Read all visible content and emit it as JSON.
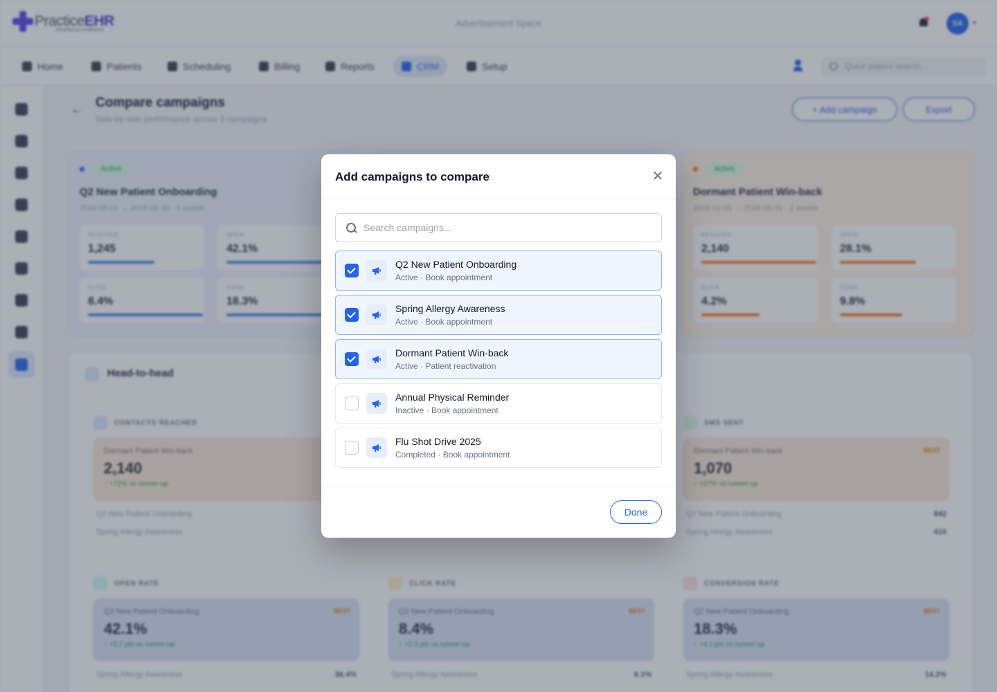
{
  "header": {
    "logo_text_plain": "Practice",
    "logo_text_bold": "EHR",
    "logo_tagline": "Simplifying Healthcare",
    "ad_space": "Advertisement Space",
    "avatar_initials": "SA",
    "quick_search_placeholder": "Quick patient search..."
  },
  "nav": {
    "items": [
      {
        "label": "Home",
        "icon": "home-icon"
      },
      {
        "label": "Patients",
        "icon": "user-icon"
      },
      {
        "label": "Scheduling",
        "icon": "calendar-icon"
      },
      {
        "label": "Billing",
        "icon": "file-icon"
      },
      {
        "label": "Reports",
        "icon": "chart-icon"
      },
      {
        "label": "CRM",
        "icon": "megaphone-icon",
        "active": true
      },
      {
        "label": "Setup",
        "icon": "gear-icon"
      }
    ]
  },
  "page": {
    "title": "Compare campaigns",
    "subtitle": "Side-by-side performance across 3 campaigns",
    "add_campaign": "+ Add campaign",
    "export": "Export"
  },
  "campaign_cards": [
    {
      "status": "Active",
      "name": "Q2 New Patient Onboarding",
      "dates": "2026-04-01 → 2026-06-30 · 4 assets",
      "dot_color": "#2563eb",
      "metrics": [
        {
          "label": "REACHED",
          "value": "1,245",
          "fill": 0.58
        },
        {
          "label": "OPEN",
          "value": "42.1%",
          "fill": 0.8
        },
        {
          "label": "CLICK",
          "value": "8.4%",
          "fill": 0.92
        },
        {
          "label": "CONV.",
          "value": "18.3%",
          "fill": 0.8
        }
      ]
    },
    {
      "status": "Active",
      "name": "Dormant Patient Win-back",
      "dates": "2026-02-01 → 2026-05-31 · 2 assets",
      "dot_color": "#f97316",
      "metrics": [
        {
          "label": "REACHED",
          "value": "2,140",
          "fill": 0.92
        },
        {
          "label": "OPEN",
          "value": "28.1%",
          "fill": 0.62
        },
        {
          "label": "CLICK",
          "value": "4.2%",
          "fill": 0.46
        },
        {
          "label": "CONV.",
          "value": "9.8%",
          "fill": 0.5
        }
      ]
    }
  ],
  "head_to_head": {
    "title": "Head-to-head",
    "blocks": [
      {
        "label": "CONTACTS REACHED",
        "winner": "Dormant Patient Win-back",
        "value": "2,140",
        "delta": "↑ +72% vs runner-up",
        "best": "",
        "tone": "orange",
        "runners": [
          {
            "name": "Q2 New Patient Onboarding",
            "value": ""
          },
          {
            "name": "Spring Allergy Awareness",
            "value": ""
          }
        ]
      },
      {
        "label": "SMS SENT",
        "winner": "Dormant Patient Win-back",
        "value": "1,070",
        "delta": "↑ +27% vs runner-up",
        "best": "BEST",
        "tone": "orange",
        "runners": [
          {
            "name": "Q2 New Patient Onboarding",
            "value": "842"
          },
          {
            "name": "Spring Allergy Awareness",
            "value": "410"
          }
        ]
      },
      {
        "label": "OPEN RATE",
        "winner": "Q2 New Patient Onboarding",
        "value": "42.1%",
        "delta": "↑ +5.7 pts vs runner-up",
        "best": "BEST",
        "tone": "blue",
        "runners": [
          {
            "name": "Spring Allergy Awareness",
            "value": "36.4%"
          }
        ]
      },
      {
        "label": "CLICK RATE",
        "winner": "Q2 New Patient Onboarding",
        "value": "8.4%",
        "delta": "↑ +2.3 pts vs runner-up",
        "best": "BEST",
        "tone": "blue",
        "runners": [
          {
            "name": "Spring Allergy Awareness",
            "value": "6.1%"
          }
        ]
      },
      {
        "label": "CONVERSION RATE",
        "winner": "Q2 New Patient Onboarding",
        "value": "18.3%",
        "delta": "↑ +4.1 pts vs runner-up",
        "best": "BEST",
        "tone": "blue",
        "runners": [
          {
            "name": "Spring Allergy Awareness",
            "value": "14.2%"
          }
        ]
      }
    ]
  },
  "modal": {
    "title": "Add campaigns to compare",
    "close_icon": "close-icon",
    "search_placeholder": "Search campaigns...",
    "search_value": "",
    "done_label": "Done",
    "options": [
      {
        "name": "Q2 New Patient Onboarding",
        "meta": "Active · Book appointment",
        "selected": true
      },
      {
        "name": "Spring Allergy Awareness",
        "meta": "Active · Book appointment",
        "selected": true
      },
      {
        "name": "Dormant Patient Win-back",
        "meta": "Active · Patient reactivation",
        "selected": true
      },
      {
        "name": "Annual Physical Reminder",
        "meta": "Inactive · Book appointment",
        "selected": false
      },
      {
        "name": "Flu Shot Drive 2025",
        "meta": "Completed · Book appointment",
        "selected": false
      }
    ]
  },
  "colors": {
    "accent": "#2563eb",
    "orange": "#f97316",
    "success": "#16a34a"
  }
}
